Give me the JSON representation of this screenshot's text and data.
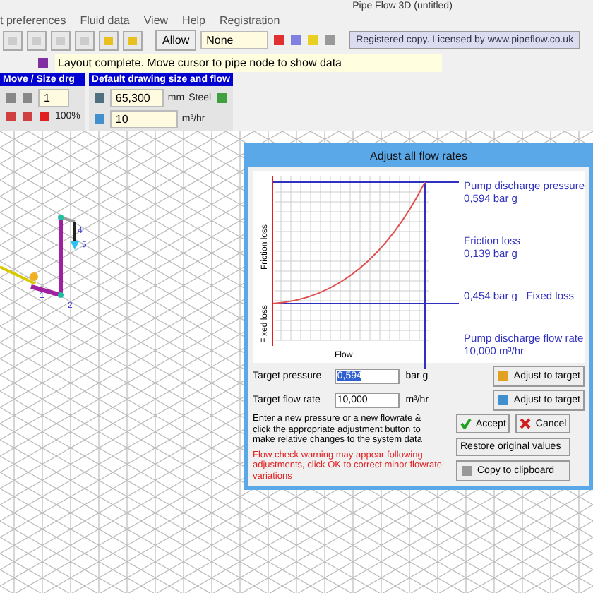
{
  "window": {
    "title": "Pipe Flow 3D (untitled)"
  },
  "menu": [
    "t preferences",
    "Fluid data",
    "View",
    "Help",
    "Registration"
  ],
  "toolbar": {
    "allow_button": "Allow",
    "node_field": "None",
    "license": "Registered copy. Licensed by www.pipeflow.co.uk"
  },
  "status": "Layout complete. Move cursor to pipe node to show data",
  "move_panel": {
    "title": "Move / Size drg",
    "step": "1",
    "zoom": "100%"
  },
  "default_panel": {
    "title": "Default drawing size and flow",
    "size": "65,300",
    "size_unit": "mm",
    "material": "Steel",
    "flow": "10",
    "flow_unit": "m³/hr"
  },
  "drawing": {
    "node_labels": [
      "1",
      "2",
      "4",
      "5"
    ]
  },
  "dialog": {
    "title": "Adjust all flow rates",
    "chart": {
      "y_top_label": "Friction loss",
      "y_bottom_label": "Fixed loss",
      "x_label": "Flow",
      "notes": [
        {
          "line1": "Pump discharge pressure",
          "line2": "0,594 bar g"
        },
        {
          "line1": "Friction loss",
          "line2": "0,139 bar g"
        },
        {
          "line1": "0,454 bar g   Fixed loss"
        },
        {
          "line1": "Pump discharge flow rate",
          "line2": "10,000 m³/hr"
        }
      ]
    },
    "fields": [
      {
        "label": "Target pressure",
        "value": "0,594",
        "unit": "bar g",
        "selected": true,
        "button": "Adjust to target"
      },
      {
        "label": "Target flow rate",
        "value": "10,000",
        "unit": "m³/hr",
        "selected": false,
        "button": "Adjust to target"
      }
    ],
    "help": "Enter a new pressure or a new flowrate & click the appropriate adjustment button to make relative changes to the system data",
    "warning": "Flow check warning may appear following adjustments, click OK to correct minor flowrate variations",
    "accept": "Accept",
    "cancel": "Cancel",
    "restore": "Restore original values",
    "copy": "Copy to clipboard"
  }
}
